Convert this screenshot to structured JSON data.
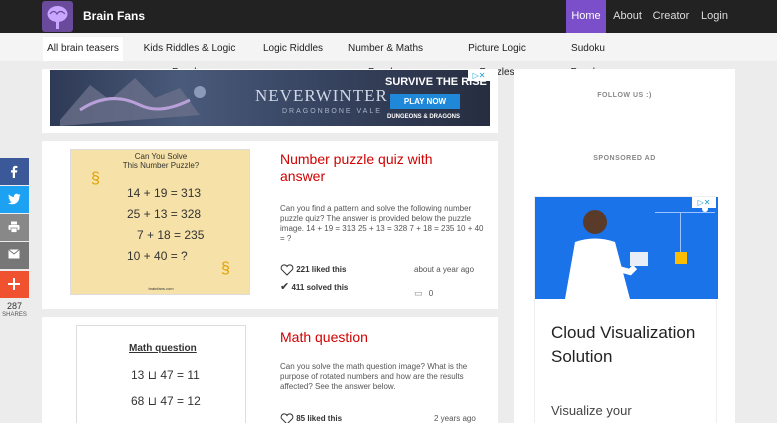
{
  "header": {
    "brand": "Brain Fans",
    "nav": [
      "Home",
      "About",
      "Creator",
      "Login"
    ]
  },
  "tabs": [
    "All brain teasers",
    "Kids Riddles & Logic Puzzles",
    "Logic Riddles",
    "Number & Maths Puzzles",
    "Picture Logic Puzzles",
    "Sudoku Puzzles"
  ],
  "top_ad": {
    "headline": "SURVIVE THE RISE",
    "game": "NEVERWINTER",
    "subtitle": "DRAGONBONE VALE",
    "cta": "PLAY NOW",
    "brand": "DUNGEONS & DRAGONS"
  },
  "posts": [
    {
      "title": "Number puzzle quiz with answer",
      "description": "Can you find a pattern and solve the following number puzzle quiz? The answer is provided below the puzzle image. 14 + 19 = 313 25 + 13 = 328 7 + 18 = 235 10 + 40 = ?",
      "likes": "221 liked this",
      "solved": "411 solved this",
      "time": "about a year ago",
      "comments": "0",
      "image": {
        "heading1": "Can You Solve",
        "heading2": "This Number Puzzle?",
        "lines": [
          "14 + 19 = 313",
          "25 + 13 = 328",
          "7 + 18 = 235",
          "10 + 40 = ?"
        ],
        "footer": "brainfans.com"
      }
    },
    {
      "title": "Math question",
      "description": "Can you solve the math question image? What is the purpose of rotated numbers and how are the results affected? See the answer below.",
      "likes": "85 liked this",
      "time": "2 years ago",
      "image": {
        "heading": "Math question",
        "lines": [
          "13 ⊔ 47 = 11",
          "68 ⊔ 47 = 12"
        ]
      }
    }
  ],
  "share": {
    "count": "287",
    "label": "SHARES"
  },
  "sidebar": {
    "follow": "FOLLOW US :)",
    "sponsored": "SPONSORED AD",
    "ad_title": "Cloud Visualization Solution",
    "ad_sub": "Visualize your"
  },
  "colors": {
    "accent": "#7b4fc9",
    "title_red": "#d20000",
    "facebook": "#3b5998",
    "twitter": "#1da1f2",
    "print": "#888888",
    "email": "#777777",
    "plus": "#f0522f"
  }
}
